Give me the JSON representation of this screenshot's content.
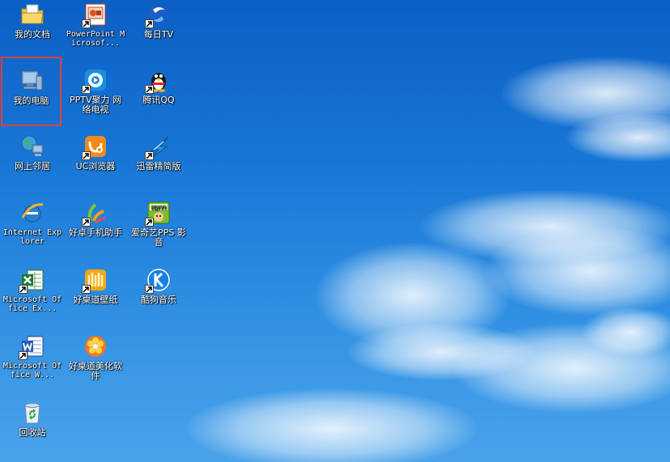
{
  "desktop": {
    "icons": [
      {
        "label": "我的文档",
        "icon": "folder-documents-icon"
      },
      {
        "label": "我的电脑",
        "icon": "my-computer-icon"
      },
      {
        "label": "网上邻居",
        "icon": "network-places-icon"
      },
      {
        "label": "Internet Explorer",
        "icon": "internet-explorer-icon"
      },
      {
        "label": "Microsoft Office Ex...",
        "icon": "excel-icon"
      },
      {
        "label": "Microsoft Office W...",
        "icon": "word-icon"
      },
      {
        "label": "回收站",
        "icon": "recycle-bin-icon"
      },
      {
        "label": "PowerPoint Microsof...",
        "icon": "powerpoint-icon"
      },
      {
        "label": "PPTV聚力 网络电视",
        "icon": "pptv-icon"
      },
      {
        "label": "UC浏览器",
        "icon": "uc-browser-icon"
      },
      {
        "label": "好卓手机助手",
        "icon": "phone-assistant-icon"
      },
      {
        "label": "好桌道壁纸",
        "icon": "wallpaper-icon"
      },
      {
        "label": "好桌道美化软件",
        "icon": "beautify-software-icon"
      },
      {
        "label": "每日TV",
        "icon": "daily-tv-icon"
      },
      {
        "label": "腾讯QQ",
        "icon": "qq-penguin-icon"
      },
      {
        "label": "迅雷精简版",
        "icon": "thunder-icon"
      },
      {
        "label": "爱奇艺PPS 影音",
        "icon": "iqiyi-icon"
      },
      {
        "label": "酷狗音乐",
        "icon": "kugou-icon"
      }
    ],
    "selected_icon": "我的电脑",
    "colors": {
      "sky": "#1877d6",
      "selection_border": "#e0403e"
    }
  }
}
